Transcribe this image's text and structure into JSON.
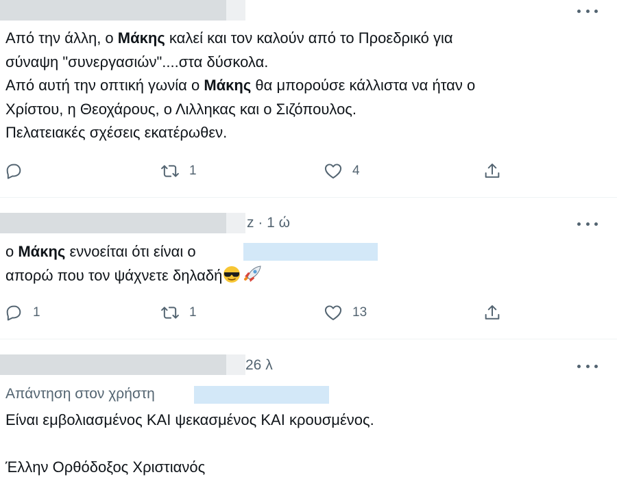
{
  "tweets": [
    {
      "meta_text": "",
      "body": {
        "line1_pre": "Από την άλλη, ο ",
        "line1_bold": "Μάκης",
        "line1_post": " καλεί και τον καλούν από το Προεδρικό για",
        "line2": "σύναψη \"συνεργασιών\"....στα δύσκολα.",
        "line3_pre": "Από αυτή την οπτική γωνία ο ",
        "line3_bold": "Μάκης",
        "line3_post": " θα μπορούσε κάλλιστα να ήταν ο",
        "line4": "Χρίστου, η Θεοχάρους, ο Λιλληκας και ο Σιζόπουλος.",
        "line5": "Πελατειακές σχέσεις εκατέρωθεν."
      },
      "actions": {
        "reply": "",
        "retweet": "1",
        "like": "4"
      }
    },
    {
      "meta_text": "z · 1 ώ",
      "body": {
        "line1_pre": "ο ",
        "line1_bold": "Μάκης",
        "line1_post": " εννοείται ότι είναι ο",
        "line2": "απορώ που τον ψάχνετε δηλαδή"
      },
      "actions": {
        "reply": "1",
        "retweet": "1",
        "like": "13"
      }
    },
    {
      "meta_text": "26 λ",
      "reply_to": "Απάντηση στον χρήστη",
      "body": {
        "line1": "Είναι εμβολιασμένος ΚΑΙ ψεκασμένος ΚΑΙ κρουσμένος.",
        "line2": "Έλλην Ορθόδοξος Χριστιανός"
      },
      "actions": {}
    }
  ],
  "icons": [
    "reply-icon",
    "retweet-icon",
    "like-icon",
    "share-icon",
    "more-icon",
    "sunglasses-emoji-icon",
    "rocket-emoji-icon"
  ],
  "colors": {
    "text": "#0f1419",
    "muted": "#536471",
    "divider": "#eff3f4",
    "redaction": "#d9dde0",
    "redaction_blue": "#d3e8f8"
  }
}
